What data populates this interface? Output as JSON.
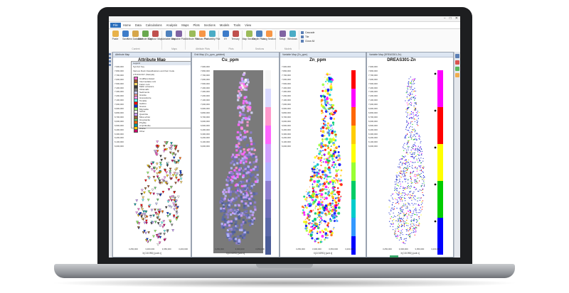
{
  "ribbon": {
    "tabs": [
      "File",
      "Home",
      "Data",
      "Calculations",
      "Analysis",
      "Maps",
      "Plots",
      "Sections",
      "Models",
      "Tools",
      "View"
    ],
    "groups": [
      {
        "name": "Content",
        "buttons": [
          "Paste",
          "Save",
          "New Database",
          "Attribute Map",
          "Contour Map"
        ]
      },
      {
        "name": "Maps",
        "buttons": [
          "Variable Map",
          "Variable Plot"
        ]
      },
      {
        "name": "Attribute Plots",
        "buttons": [
          "Attribute Plot",
          "Mosaic Plot",
          "Probability Plot"
        ]
      },
      {
        "name": "Plots",
        "buttons": [
          "XY",
          "Ternary"
        ]
      },
      {
        "name": "Sections",
        "buttons": [
          "Map Section",
          "Depth Plots",
          "Long Section"
        ]
      },
      {
        "name": "Models",
        "buttons": [
          "Setup",
          "Windows"
        ]
      }
    ],
    "side_items": [
      "Cascade",
      "Tile",
      "Close All"
    ]
  },
  "window_controls": {
    "minimize": "−",
    "maximize": "□",
    "close": "✕"
  },
  "panes": [
    {
      "title_bar": "Attribute Map",
      "map_title": "Attribute Map",
      "x_axis_ticks": [
        "3,250,000",
        "3,300,000",
        "3,350,000",
        "3,400,000"
      ],
      "y_axis_ticks": [
        "7,900,000",
        "7,800,000",
        "7,700,000",
        "7,600,000",
        "7,500,000",
        "7,400,000",
        "7,300,000",
        "7,200,000",
        "7,100,000",
        "7,000,000",
        "6,900,000",
        "6,800,000",
        "6,700,000",
        "6,600,000",
        "6,500,000",
        "6,400,000",
        "6,300,000",
        "6,200,000",
        "6,100,000",
        "6,000,000"
      ],
      "x_axis_label": "X(COORD) [unit x]",
      "legend": {
        "header": "Legend",
        "title": "Symbol Key",
        "subtitle": "Various Rock Classifications and their Code",
        "group": "LITHOLOGY (Sample)",
        "entries": [
          {
            "label": "Undifferentiated",
            "color": "#ff66cc"
          },
          {
            "label": "Intermediate rock",
            "color": "#a0522d"
          },
          {
            "label": "Felsic rock",
            "color": "#ffd966"
          },
          {
            "label": "Mafic volcanics",
            "color": "#3a3a3a"
          },
          {
            "label": "Ultramafic",
            "color": "#7f7f7f"
          },
          {
            "label": "Sediments",
            "color": "#c9c9ff"
          },
          {
            "label": "Granite",
            "color": "#ff9999"
          },
          {
            "label": "Granodiorite",
            "color": "#ff99ff"
          },
          {
            "label": "Tonalite",
            "color": "#66ffff"
          },
          {
            "label": "Gabbro",
            "color": "#ff0000"
          },
          {
            "label": "Gneiss",
            "color": "#0033cc"
          },
          {
            "label": "Migmatite",
            "color": "#99ff66"
          },
          {
            "label": "Schist",
            "color": "#ffffff"
          },
          {
            "label": "Quartzite",
            "color": "#cc99ff"
          },
          {
            "label": "Mica schist",
            "color": "#996633"
          },
          {
            "label": "Greywacke",
            "color": "#66cc66"
          },
          {
            "label": "Phyllite",
            "color": "#ff6600"
          },
          {
            "label": "Amphibolite",
            "color": "#009999"
          },
          {
            "label": "Diorite",
            "color": "#ffcc00"
          },
          {
            "label": "Other",
            "color": "#cc0066"
          }
        ]
      }
    },
    {
      "title_bar": "Grid Map (Cu_ppm_gridded)",
      "map_title": "Cu_ppm",
      "x_axis_label": "X(COORD) [unit x]",
      "color_ramp": [
        "#f7f7f7",
        "#d9d9ff",
        "#ff99cc",
        "#ff66ff",
        "#d0a0ff",
        "#b4b4ff",
        "#8e7fd0",
        "#6e6fb8",
        "#5a68a8",
        "#4a5c98"
      ],
      "y_axis_ticks": [
        "7,900,000",
        "7,800,000",
        "7,700,000",
        "7,600,000",
        "7,500,000",
        "7,400,000",
        "7,300,000",
        "7,200,000",
        "7,100,000",
        "7,000,000",
        "6,900,000",
        "6,800,000",
        "6,700,000",
        "6,600,000",
        "6,500,000",
        "6,400,000",
        "6,300,000",
        "6,200,000",
        "6,100,000",
        "6,000,000"
      ],
      "x_axis_ticks": [
        "3,250,000",
        "3,300,000",
        "3,350,000"
      ]
    },
    {
      "title_bar": "Variable Map (Zn_ppm)",
      "map_title": "Zn_ppm",
      "x_axis_label": "X(COORD) [unit x]",
      "legend_colors": [
        "#ff0000",
        "#ff00ff",
        "#ff6600",
        "#ffcc00",
        "#ffff00",
        "#99ff33",
        "#00cc66",
        "#00cccc",
        "#3399ff",
        "#0000ff"
      ],
      "y_axis_ticks": [
        "7,900,000",
        "7,800,000",
        "7,700,000",
        "7,600,000",
        "7,500,000",
        "7,400,000",
        "7,300,000",
        "7,200,000",
        "7,100,000",
        "7,000,000",
        "6,900,000",
        "6,800,000",
        "6,700,000",
        "6,600,000",
        "6,500,000",
        "6,400,000",
        "6,300,000",
        "6,200,000",
        "6,100,000",
        "6,000,000"
      ],
      "x_axis_ticks": [
        "3,250,000",
        "3,300,000",
        "3,350,000",
        "3,400,000"
      ]
    },
    {
      "title_bar": "Variable Map (DREAS301-Zn)",
      "map_title": "DREAS301-Zn",
      "x_axis_label": "X(COORD) [unit x]",
      "legend_colors": [
        "#ff00ff",
        "#ff0000",
        "#ffff00",
        "#00cc00",
        "#0000ff"
      ],
      "y_axis_ticks": [
        "7,900,000",
        "7,800,000",
        "7,700,000",
        "7,600,000",
        "7,500,000",
        "7,400,000",
        "7,300,000",
        "7,200,000",
        "7,100,000",
        "7,000,000",
        "6,900,000",
        "6,800,000",
        "6,700,000",
        "6,600,000",
        "6,500,000",
        "6,400,000",
        "6,300,000",
        "6,200,000",
        "6,100,000",
        "6,000,000"
      ],
      "x_axis_ticks": [
        "3,250,000",
        "3,300,000",
        "3,350,000",
        "3,400,000"
      ]
    }
  ]
}
